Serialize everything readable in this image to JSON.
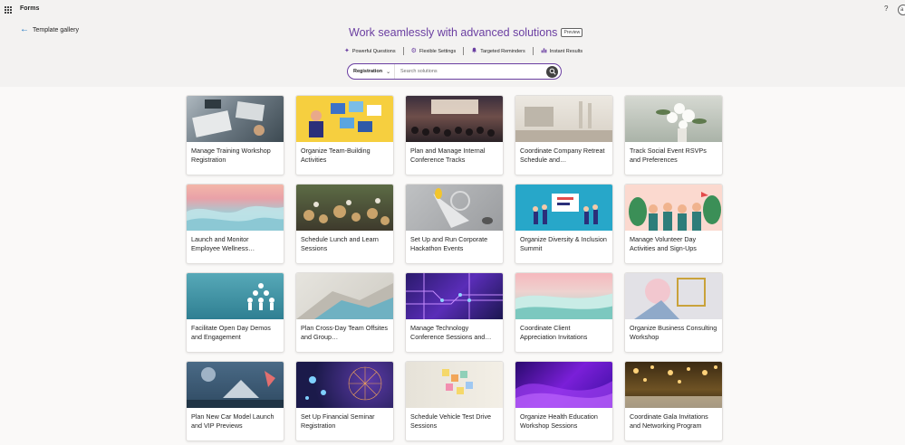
{
  "app": {
    "name": "Forms",
    "help": "?",
    "avatar": "a"
  },
  "nav": {
    "back_label": "Template gallery"
  },
  "hero": {
    "title": "Work seamlessly with advanced solutions",
    "badge": "Preview",
    "features": [
      {
        "label": "Powerful Questions",
        "icon": "sparkle-icon"
      },
      {
        "label": "Flexible Settings",
        "icon": "gear-icon"
      },
      {
        "label": "Targeted Reminders",
        "icon": "bell-icon"
      },
      {
        "label": "Instant Results",
        "icon": "chart-icon"
      }
    ]
  },
  "search": {
    "category": "Registration",
    "placeholder": "Search solutions"
  },
  "colors": {
    "accent": "#6a3ea1",
    "link": "#0f6cbd"
  },
  "templates": [
    {
      "title": "Manage Training Workshop Registration",
      "image": "workshop-desk"
    },
    {
      "title": "Organize Team-Building Activities",
      "image": "team-illustration"
    },
    {
      "title": "Plan and Manage Internal Conference Tracks",
      "image": "conference-hall"
    },
    {
      "title": "Coordinate Company Retreat Schedule and…",
      "image": "office-laptop"
    },
    {
      "title": "Track Social Event RSVPs and Preferences",
      "image": "flowers-table"
    },
    {
      "title": "Launch and Monitor Employee Wellness…",
      "image": "abstract-waves"
    },
    {
      "title": "Schedule Lunch and Learn Sessions",
      "image": "food-table"
    },
    {
      "title": "Set Up and Run Corporate Hackathon Events",
      "image": "abstract-sculpture"
    },
    {
      "title": "Organize Diversity & Inclusion Summit",
      "image": "people-illustration"
    },
    {
      "title": "Manage Volunteer Day Activities and Sign-Ups",
      "image": "volunteers-illustration"
    },
    {
      "title": "Facilitate Open Day Demos and Engagement",
      "image": "paper-figures"
    },
    {
      "title": "Plan Cross-Day Team Offsites and Group…",
      "image": "abstract-steps"
    },
    {
      "title": "Manage Technology Conference Sessions and…",
      "image": "circuit-board"
    },
    {
      "title": "Coordinate Client Appreciation Invitations",
      "image": "pastel-waves"
    },
    {
      "title": "Organize Business Consulting Workshop",
      "image": "geometric-shapes"
    },
    {
      "title": "Plan New Car Model Launch and VIP Previews",
      "image": "paper-shapes"
    },
    {
      "title": "Set Up Financial Seminar Registration",
      "image": "tech-network"
    },
    {
      "title": "Schedule Vehicle Test Drive Sessions",
      "image": "sticky-notes"
    },
    {
      "title": "Organize Health Education Workshop Sessions",
      "image": "purple-waves"
    },
    {
      "title": "Coordinate Gala Invitations and Networking Program",
      "image": "gala-lights"
    }
  ]
}
